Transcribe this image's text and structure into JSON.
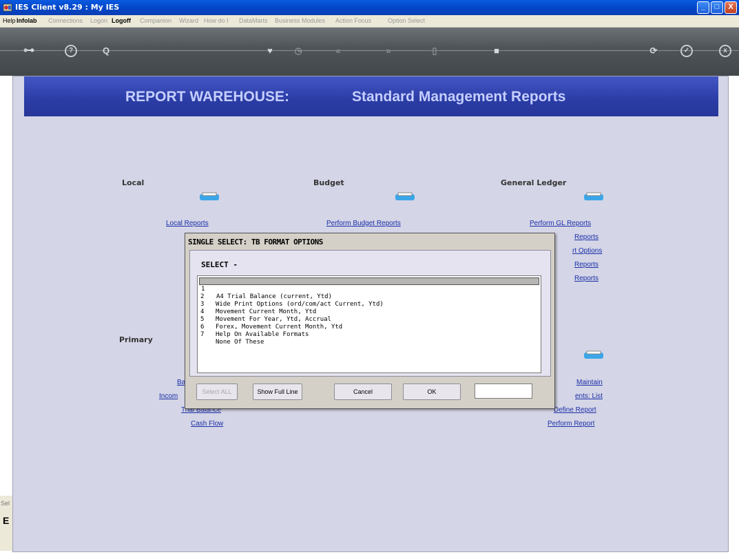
{
  "window": {
    "title": "IES Client v8.29 : My IES",
    "min_label": "_",
    "max_label": "□",
    "close_label": "X"
  },
  "menu": [
    {
      "label": "Help",
      "active": true
    },
    {
      "label": "Infolab",
      "active": true
    },
    {
      "label": "Connections",
      "active": false
    },
    {
      "label": "Logon",
      "active": false
    },
    {
      "label": "Logoff",
      "active": true
    },
    {
      "label": "Companion",
      "active": false
    },
    {
      "label": "Wizard",
      "active": false
    },
    {
      "label": "How do I",
      "active": false
    },
    {
      "label": "DataMarts",
      "active": false
    },
    {
      "label": "Business Modules",
      "active": false
    },
    {
      "label": "Action Focus",
      "active": false
    },
    {
      "label": "Option Select",
      "active": false
    }
  ],
  "toolbar": {
    "key": "⊶",
    "help": "?",
    "search": "Q",
    "heart": "♥",
    "clock": "◷",
    "back": "«",
    "forward": "»",
    "doc": "▯",
    "stop": "■",
    "refresh": "⟳",
    "ok": "✓",
    "close": "x"
  },
  "banner": {
    "left": "REPORT WAREHOUSE:",
    "right": "Standard Management Reports"
  },
  "sections": {
    "local": "Local",
    "budget": "Budget",
    "general_ledger": "General Ledger",
    "primary": "Primary"
  },
  "links": {
    "local_reports": "Local Reports",
    "perform_budget_reports": "Perform Budget Reports",
    "perform_gl_reports": "Perform GL Reports",
    "gl_reports_2": "Reports",
    "gl_report_options": "rt Options",
    "gl_reports_3": "Reports",
    "gl_reports_4": "Reports",
    "ba_partial": "Ba",
    "income_partial": "Incom",
    "trial_balance": "Trial Balance",
    "cash_flow": "Cash Flow",
    "maintain": "Maintain",
    "statements_list": "ents: List",
    "define_report": "Define Report",
    "perform_report": "Perform Report"
  },
  "status": {
    "s1": "Sel",
    "s2": "E"
  },
  "dialog": {
    "title": "SINGLE SELECT: TB FORMAT OPTIONS",
    "select_label": "SELECT -",
    "options": [
      {
        "num": "1",
        "text": "A4 Trial Balance (current, Ytd)",
        "selected": true
      },
      {
        "num": "2",
        "text": "Wide Print Options (ord/com/act Current, Ytd)",
        "selected": false
      },
      {
        "num": "3",
        "text": "Movement Current Month, Ytd",
        "selected": false
      },
      {
        "num": "4",
        "text": "Movement For Year, Ytd, Accrual",
        "selected": false
      },
      {
        "num": "5",
        "text": "Forex, Movement Current Month, Ytd",
        "selected": false
      },
      {
        "num": "6",
        "text": "Help On Available Formats",
        "selected": false
      },
      {
        "num": "7",
        "text": "None Of These",
        "selected": false
      }
    ],
    "buttons": {
      "select_all": "Select ALL",
      "show_full_line": "Show Full Line",
      "cancel": "Cancel",
      "ok": "OK"
    },
    "input_value": ""
  }
}
